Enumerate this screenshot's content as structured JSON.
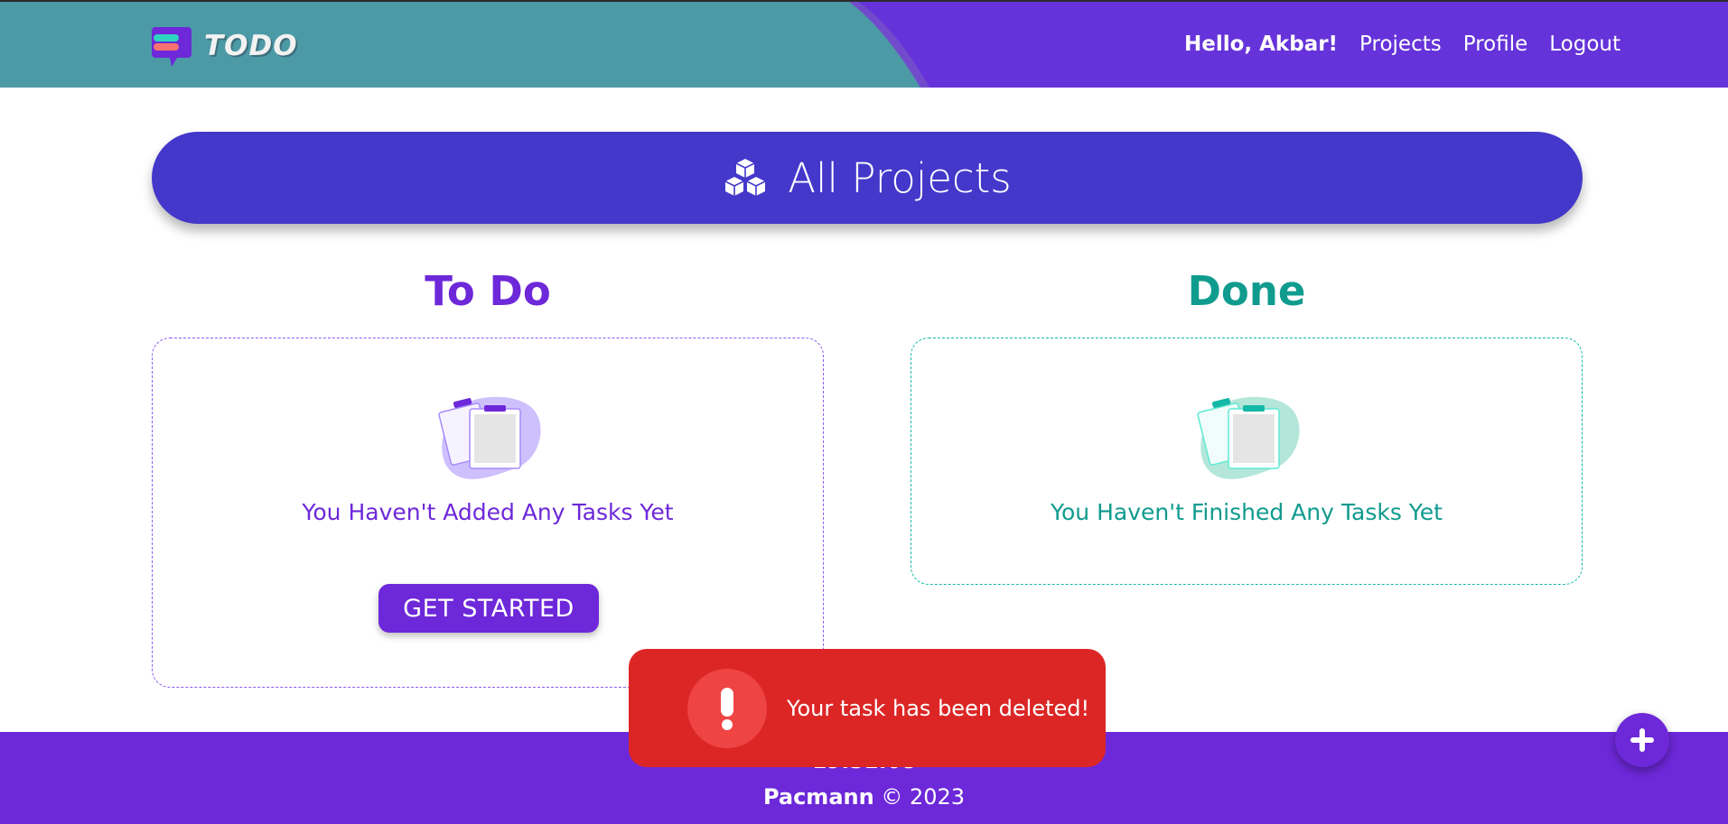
{
  "navbar": {
    "brand": "TODO",
    "greeting": "Hello, Akbar!",
    "links": [
      "Projects",
      "Profile",
      "Logout"
    ]
  },
  "header": {
    "title": "All Projects",
    "icon": "cubes-icon"
  },
  "todo": {
    "title": "To Do",
    "empty_message": "You Haven't Added Any Tasks Yet",
    "button_label": "GET STARTED"
  },
  "done": {
    "title": "Done",
    "empty_message": "You Haven't Finished Any Tasks Yet"
  },
  "footer": {
    "time": "19:31:08",
    "company": "Pacmann",
    "copyright": "© 2023"
  },
  "toast": {
    "message": "Your task has been deleted!",
    "icon": "exclamation-icon"
  },
  "fab": {
    "icon": "plus-icon"
  },
  "colors": {
    "primary": "#6d28d9",
    "header_pill": "#4338ca",
    "teal": "#0f9b8e",
    "toast": "#dc2626"
  }
}
